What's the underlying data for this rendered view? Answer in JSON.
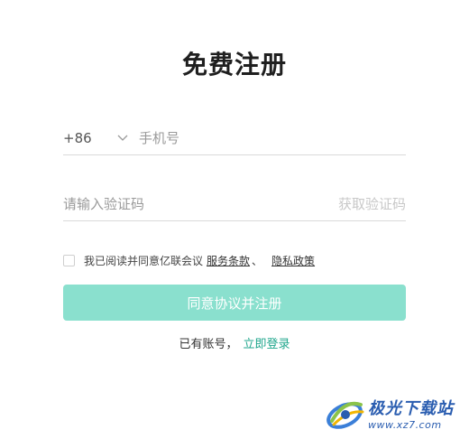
{
  "title": "免费注册",
  "phone": {
    "country_code": "+86",
    "placeholder": "手机号"
  },
  "verify": {
    "placeholder": "请输入验证码",
    "get_code": "获取验证码"
  },
  "agreement": {
    "text": "我已阅读并同意亿联会议",
    "terms": "服务条款",
    "separator": "、",
    "privacy": "隐私政策"
  },
  "submit_label": "同意协议并注册",
  "login": {
    "prompt": "已有账号，",
    "link": "立即登录"
  },
  "watermark": {
    "name": "极光下载站",
    "url": "www.xz7.com"
  },
  "colors": {
    "accent": "#1fa68c",
    "button_bg": "#8ae0ce",
    "watermark": "#2a5db0"
  }
}
